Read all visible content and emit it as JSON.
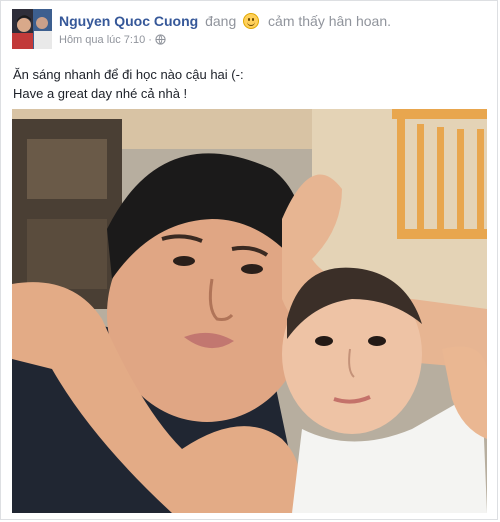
{
  "post": {
    "author": "Nguyen Quoc Cuong",
    "verb": "đang",
    "feeling_icon": "smiley-face-icon",
    "feeling": "cảm thấy hân hoan.",
    "timestamp": "Hôm qua lúc 7:10",
    "separator": "·",
    "privacy_icon": "globe-icon",
    "text_lines": [
      "Ăn sáng nhanh để đi học nào cậu hai (-:",
      "Have a great day nhé cả nhà !"
    ]
  }
}
